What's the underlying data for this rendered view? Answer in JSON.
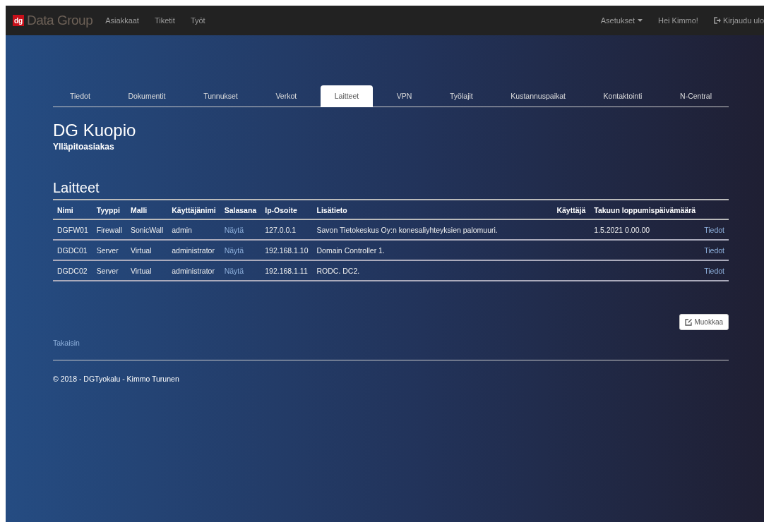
{
  "navbar": {
    "logo_mark": "dg",
    "brand": "Data Group",
    "links": [
      "Asiakkaat",
      "Tiketit",
      "Työt"
    ],
    "settings": "Asetukset",
    "greeting": "Hei Kimmo!",
    "logout": "Kirjaudu ulo"
  },
  "tabs": [
    {
      "label": "Tiedot",
      "selected": false
    },
    {
      "label": "Dokumentit",
      "selected": false
    },
    {
      "label": "Tunnukset",
      "selected": false
    },
    {
      "label": "Verkot",
      "selected": false
    },
    {
      "label": "Laitteet",
      "selected": true
    },
    {
      "label": "VPN",
      "selected": false
    },
    {
      "label": "Työlajit",
      "selected": false
    },
    {
      "label": "Kustannuspaikat",
      "selected": false
    },
    {
      "label": "Kontaktointi",
      "selected": false
    },
    {
      "label": "N-Central",
      "selected": false
    }
  ],
  "customer": {
    "name": "DG Kuopio",
    "type": "Ylläpitoasiakas"
  },
  "section_title": "Laitteet",
  "table": {
    "columns": [
      "Nimi",
      "Tyyppi",
      "Malli",
      "Käyttäjänimi",
      "Salasana",
      "Ip-Osoite",
      "Lisätieto",
      "Käyttäjä",
      "Takuun loppumispäivämäärä"
    ],
    "rows": [
      {
        "name": "DGFW01",
        "type": "Firewall",
        "model": "SonicWall",
        "username": "admin",
        "password_link": "Näytä",
        "ip": "127.0.0.1",
        "info": "Savon Tietokeskus Oy:n konesaliyhteyksien palomuuri.",
        "warranty": "1.5.2021 0.00.00",
        "details_link": "Tiedot"
      },
      {
        "name": "DGDC01",
        "type": "Server",
        "model": "Virtual",
        "username": "administrator",
        "password_link": "Näytä",
        "ip": "192.168.1.10",
        "info": "Domain Controller 1.",
        "details_link": "Tiedot"
      },
      {
        "name": "DGDC02",
        "type": "Server",
        "model": "Virtual",
        "username": "administrator",
        "password_link": "Näytä",
        "ip": "192.168.1.11",
        "info": "RODC. DC2.",
        "details_link": "Tiedot"
      }
    ]
  },
  "edit_button": "Muokkaa",
  "back_link": "Takaisin",
  "footer": "© 2018 - DGTyokalu - Kimmo Turunen"
}
